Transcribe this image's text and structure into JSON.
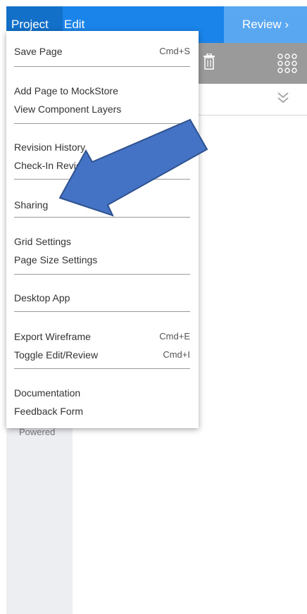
{
  "menubar": {
    "project": "Project",
    "edit": "Edit",
    "review": "Review  ›"
  },
  "toolbar": {
    "trash": "trash-icon",
    "grid": "grid-icon",
    "expand": "chevrons-down-icon"
  },
  "sidebar": {
    "partial_text": "Powered"
  },
  "dropdown": {
    "save_page": "Save Page",
    "save_page_shortcut": "Cmd+S",
    "add_page": "Add Page to MockStore",
    "view_layers": "View Component Layers",
    "revision_history": "Revision History",
    "check_in": "Check-In Review",
    "sharing": "Sharing",
    "grid_settings": "Grid Settings",
    "page_size": "Page Size Settings",
    "desktop_app": "Desktop App",
    "export": "Export Wireframe",
    "export_shortcut": "Cmd+E",
    "toggle": "Toggle Edit/Review",
    "toggle_shortcut": "Cmd+I",
    "documentation": "Documentation",
    "feedback": "Feedback Form"
  },
  "colors": {
    "bar": "#1a84ea",
    "active_tab": "#1270c9",
    "review": "#5aa7f1",
    "arrow": "#4472c4"
  }
}
